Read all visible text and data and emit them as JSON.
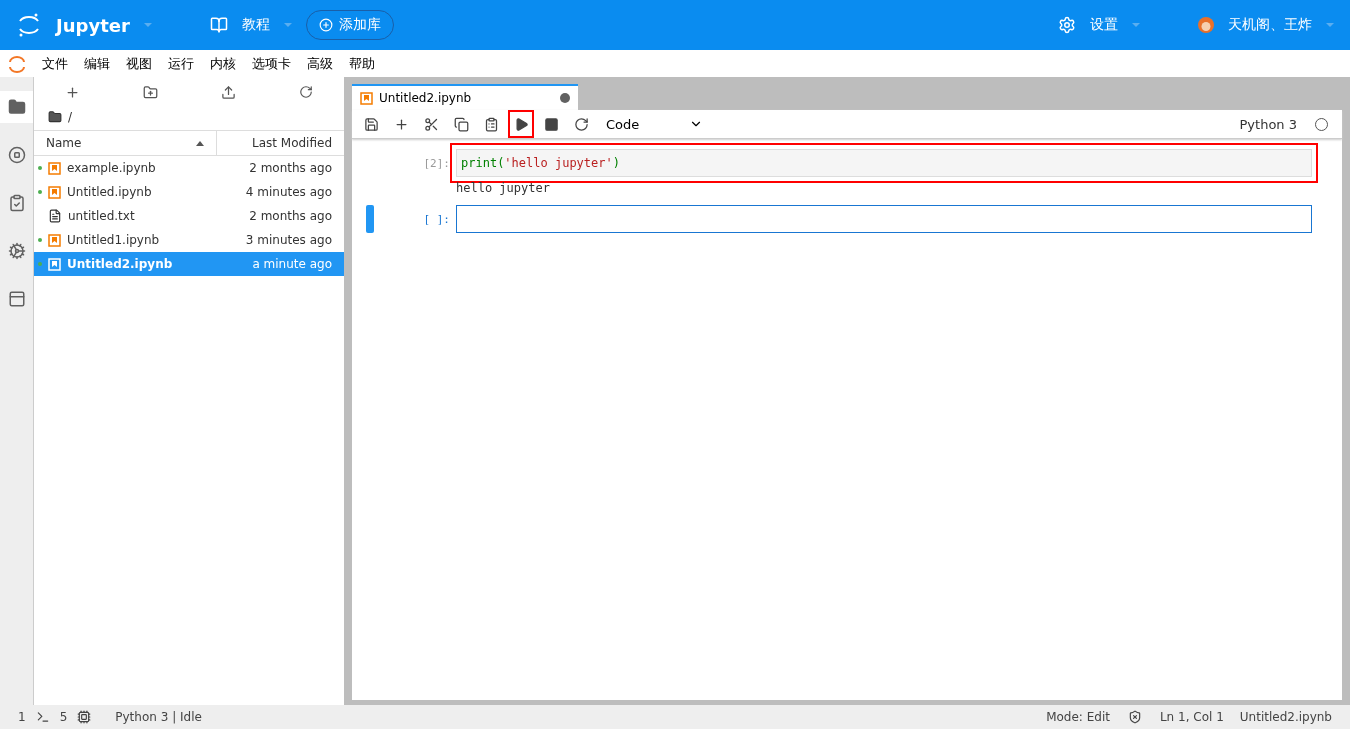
{
  "header": {
    "brand": "Jupyter",
    "tutorial": "教程",
    "add_library": "添加库",
    "settings": "设置",
    "user": "天机阁、王炸"
  },
  "menu": [
    "文件",
    "编辑",
    "视图",
    "运行",
    "内核",
    "选项卡",
    "高级",
    "帮助"
  ],
  "sidebar_tabs": [
    {
      "kind": "folder",
      "selected": true
    },
    {
      "kind": "running",
      "selected": false
    },
    {
      "kind": "commands",
      "selected": false
    },
    {
      "kind": "settings",
      "selected": false
    },
    {
      "kind": "tabs",
      "selected": false
    }
  ],
  "file_browser": {
    "path": "/",
    "columns": [
      "Name",
      "Last Modified"
    ],
    "files": [
      {
        "name": "example.ipynb",
        "modified": "2 months ago",
        "kind": "notebook",
        "running": true,
        "selected": false
      },
      {
        "name": "Untitled.ipynb",
        "modified": "4 minutes ago",
        "kind": "notebook",
        "running": true,
        "selected": false
      },
      {
        "name": "untitled.txt",
        "modified": "2 months ago",
        "kind": "text",
        "running": false,
        "selected": false
      },
      {
        "name": "Untitled1.ipynb",
        "modified": "3 minutes ago",
        "kind": "notebook",
        "running": true,
        "selected": false
      },
      {
        "name": "Untitled2.ipynb",
        "modified": "a minute ago",
        "kind": "notebook",
        "running": true,
        "selected": true
      }
    ]
  },
  "notebook": {
    "tab": {
      "title": "Untitled2.ipynb",
      "dirty": true
    },
    "toolbar": [
      {
        "kind": "save",
        "highlighted": false
      },
      {
        "kind": "add",
        "highlighted": false
      },
      {
        "kind": "cut",
        "highlighted": false
      },
      {
        "kind": "copy",
        "highlighted": false
      },
      {
        "kind": "paste",
        "highlighted": false
      },
      {
        "kind": "run",
        "highlighted": true
      },
      {
        "kind": "stop",
        "highlighted": false
      },
      {
        "kind": "restart",
        "highlighted": false
      }
    ],
    "cell_type": "Code",
    "kernel": "Python 3",
    "kernel_busy": false,
    "cells": [
      {
        "prompt": "[2]:",
        "active": false,
        "highlighted": true,
        "code": [
          {
            "kind": "builtin",
            "text": "print"
          },
          {
            "kind": "paren",
            "text": "("
          },
          {
            "kind": "string",
            "text": "'hello jupyter'"
          },
          {
            "kind": "paren",
            "text": ")"
          }
        ],
        "output": "hello jupyter"
      },
      {
        "prompt": "[ ]:",
        "active": true,
        "highlighted": false
      }
    ]
  },
  "status_bar": {
    "terminals": "1",
    "kernels": "5",
    "kernel_status": "Python 3 | Idle",
    "mode": "Mode: Edit",
    "position": "Ln 1, Col 1",
    "file": "Untitled2.ipynb"
  }
}
